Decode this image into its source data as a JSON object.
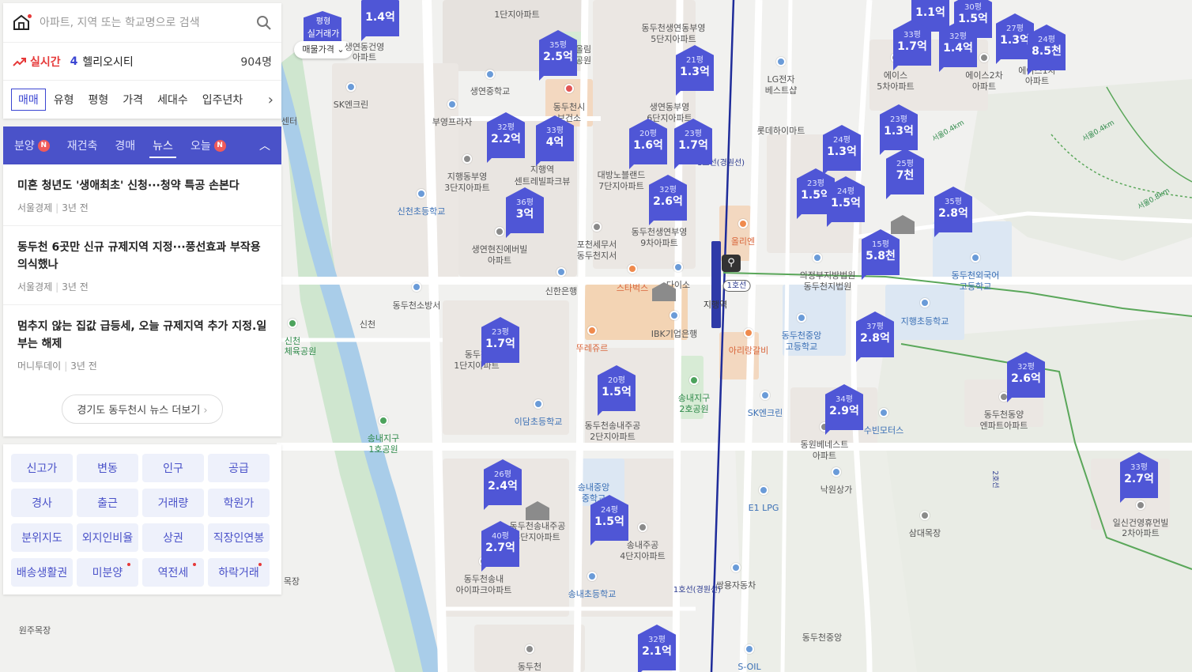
{
  "search": {
    "placeholder": "아파트, 지역 또는 학교명으로 검색"
  },
  "live": {
    "label": "실시간",
    "rank": "4",
    "name": "헬리오시티",
    "count": "904명"
  },
  "filters": [
    "매매",
    "유형",
    "평형",
    "가격",
    "세대수",
    "입주년차"
  ],
  "tabs": [
    {
      "label": "분양",
      "badge": "N"
    },
    {
      "label": "재건축",
      "badge": ""
    },
    {
      "label": "경매",
      "badge": ""
    },
    {
      "label": "뉴스",
      "badge": ""
    },
    {
      "label": "오늘",
      "badge": "N"
    }
  ],
  "news": [
    {
      "title": "미혼 청년도 '생애최초' 신청···청약 특공 손본다",
      "source": "서울경제",
      "time": "3년 전"
    },
    {
      "title": "동두천 6곳만 신규 규제지역 지정···풍선효과 부작용 의식했나",
      "source": "서울경제",
      "time": "3년 전"
    },
    {
      "title": "멈추지 않는 집값 급등세, 오늘 규제지역 추가 지정.일부는 해제",
      "source": "머니투데이",
      "time": "3년 전"
    }
  ],
  "news_more": "경기도 동두천시 뉴스 더보기",
  "grid_buttons": [
    {
      "label": "신고가",
      "dot": false
    },
    {
      "label": "변동",
      "dot": false
    },
    {
      "label": "인구",
      "dot": false
    },
    {
      "label": "공급",
      "dot": false
    },
    {
      "label": "경사",
      "dot": false
    },
    {
      "label": "출근",
      "dot": false
    },
    {
      "label": "거래량",
      "dot": false
    },
    {
      "label": "학원가",
      "dot": false
    },
    {
      "label": "분위지도",
      "dot": false
    },
    {
      "label": "외지인비율",
      "dot": false
    },
    {
      "label": "상권",
      "dot": false
    },
    {
      "label": "직장인연봉",
      "dot": false
    },
    {
      "label": "배송생활권",
      "dot": false
    },
    {
      "label": "미분양",
      "dot": true
    },
    {
      "label": "역전세",
      "dot": true
    },
    {
      "label": "하락거래",
      "dot": true
    }
  ],
  "map_toggle": {
    "top": "평형",
    "top2": "실거래가",
    "bottom": "매물가격"
  },
  "markers": [
    {
      "size": "",
      "price": "1.4억"
    },
    {
      "size": "35평",
      "price": "2.5억"
    },
    {
      "size": "21평",
      "price": "1.3억"
    },
    {
      "size": "32평",
      "price": "2.2억"
    },
    {
      "size": "33평",
      "price": "4억"
    },
    {
      "size": "20평",
      "price": "1.6억"
    },
    {
      "size": "23평",
      "price": "1.7억"
    },
    {
      "size": "32평",
      "price": "2.6억"
    },
    {
      "size": "36평",
      "price": "3억"
    },
    {
      "size": "23평",
      "price": "1.7억"
    },
    {
      "size": "20평",
      "price": "1.5억"
    },
    {
      "size": "26평",
      "price": "2.4억"
    },
    {
      "size": "40평",
      "price": "2.7억"
    },
    {
      "size": "24평",
      "price": "1.5억"
    },
    {
      "size": "32평",
      "price": "2.1억"
    },
    {
      "size": "",
      "price": "1.1억"
    },
    {
      "size": "30평",
      "price": "1.5억"
    },
    {
      "size": "33평",
      "price": "1.7억"
    },
    {
      "size": "32평",
      "price": "1.4억"
    },
    {
      "size": "27평",
      "price": "1.3억"
    },
    {
      "size": "24평",
      "price": "8.5천"
    },
    {
      "size": "23평",
      "price": "1.3억"
    },
    {
      "size": "24평",
      "price": "1.3억"
    },
    {
      "size": "25평",
      "price": "7천"
    },
    {
      "size": "23평",
      "price": "1.5억"
    },
    {
      "size": "24평",
      "price": "1.5억"
    },
    {
      "size": "35평",
      "price": "2.8억"
    },
    {
      "size": "15평",
      "price": "5.8천"
    },
    {
      "size": "37평",
      "price": "2.8억"
    },
    {
      "size": "32평",
      "price": "2.6억"
    },
    {
      "size": "34평",
      "price": "2.9억"
    },
    {
      "size": "33평",
      "price": "2.7억"
    }
  ],
  "map_labels": [
    "생연동건영",
    "아파트",
    "1단지아파트",
    "동두천생연동부영",
    "5단지아파트",
    "올림",
    "공원",
    "생연중학교",
    "SK엔크린",
    "부영프라자",
    "동두천시",
    "보건소",
    "생연동부영",
    "6단지아파트",
    "센터",
    "LG전자",
    "베스트샵",
    "에이스",
    "5차아파트",
    "에이스2차",
    "아파트",
    "에이스1차",
    "아파트",
    "롯데하이마트",
    "지행동부영",
    "3단지아파트",
    "지행역",
    "센트레빌파크뷰",
    "대방노블랜드",
    "7단지아파트",
    "신천초등학교",
    "생연현진에버빌",
    "아파트",
    "포천세무서",
    "동두천지서",
    "동두천생연부영",
    "9차아파트",
    "올리엔",
    "의정부지방법원",
    "동두천지법원",
    "동두천외국어",
    "고등학교",
    "신한은행",
    "스타벅스",
    "다이소",
    "1호선",
    "지행역",
    "동두천소방서",
    "신천",
    "IBK기업은행",
    "지행초등학교",
    "동두천중앙",
    "고등학교",
    "동두천",
    "1단지아파트",
    "뚜레쥬르",
    "아리랑갈비",
    "신천",
    "체육공원",
    "송내지구",
    "2호공원",
    "SK엔크린",
    "수빈모터스",
    "동두천동양",
    "엔파트아파트",
    "이담초등학교",
    "동두천송내주공",
    "2단지아파트",
    "송내지구",
    "1호공원",
    "동원베네스트",
    "아파트",
    "낙원상가",
    "송내중앙",
    "중학교",
    "동두천송내주공",
    "3단지아파트",
    "E1 LPG",
    "일신건영휴먼빌",
    "2차아파트",
    "삼대목장",
    "송내주공",
    "4단지아파트",
    "동두천송내",
    "아이파크아파트",
    "송내초등학교",
    "쌍용자동차",
    "1호선(경원선)",
    "목장",
    "원주목장",
    "동두천",
    "S-OIL",
    "1호선(경원선)",
    "동두천중앙",
    "2호선",
    "서울0.4km",
    "서울0.8km",
    "서울0.4km"
  ]
}
